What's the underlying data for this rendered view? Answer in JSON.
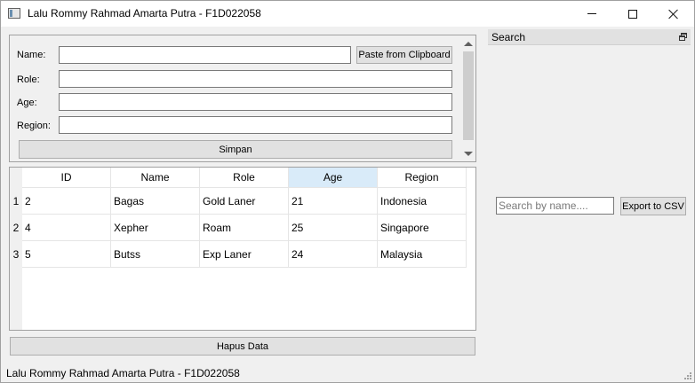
{
  "window": {
    "title": "Lalu Rommy Rahmad Amarta Putra - F1D022058"
  },
  "form": {
    "name_label": "Name:",
    "name_value": "",
    "paste_button": "Paste from Clipboard",
    "role_label": "Role:",
    "role_value": "",
    "age_label": "Age:",
    "age_value": "",
    "region_label": "Region:",
    "region_value": "",
    "save_button": "Simpan"
  },
  "table": {
    "columns": [
      "ID",
      "Name",
      "Role",
      "Age",
      "Region"
    ],
    "selected_column": "Age",
    "rows": [
      {
        "row_num": "1",
        "cells": [
          "2",
          "Bagas",
          "Gold Laner",
          "21",
          "Indonesia"
        ]
      },
      {
        "row_num": "2",
        "cells": [
          "4",
          "Xepher",
          "Roam",
          "25",
          "Singapore"
        ]
      },
      {
        "row_num": "3",
        "cells": [
          "5",
          "Butss",
          "Exp Laner",
          "24",
          "Malaysia"
        ]
      }
    ]
  },
  "delete_button": "Hapus Data",
  "search_dock": {
    "title": "Search",
    "search_placeholder": "Search by name....",
    "search_value": "",
    "export_button": "Export to CSV"
  },
  "status_bar": {
    "text": "Lalu Rommy Rahmad Amarta Putra - F1D022058"
  },
  "icons": {
    "app": "window-app-icon",
    "minimize": "minimize-icon",
    "maximize": "maximize-icon",
    "close": "close-icon",
    "float": "float-dock-icon"
  },
  "colors": {
    "selected_header": "#d9ebf9",
    "window_bg": "#f0f0f0",
    "button_bg": "#e1e1e1"
  }
}
